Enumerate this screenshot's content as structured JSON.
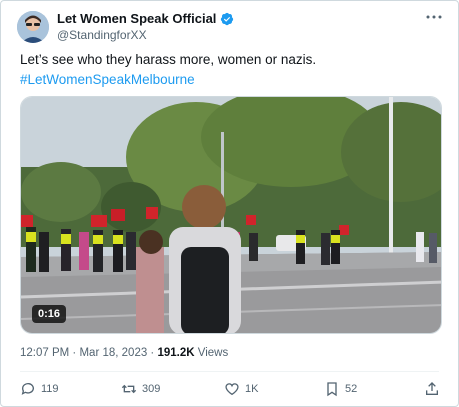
{
  "author": {
    "display_name": "Let Women Speak Official",
    "handle": "@StandingforXX",
    "verified": true
  },
  "tweet": {
    "text": "Let’s see who they harass more, women or nazis.",
    "hashtag": "#LetWomenSpeakMelbourne"
  },
  "media": {
    "type": "video",
    "duration": "0:16"
  },
  "meta": {
    "time": "12:07 PM",
    "separator": " · ",
    "date": "Mar 18, 2023",
    "views_count": "191.2K",
    "views_label": " Views"
  },
  "actions": {
    "replies": "119",
    "retweets": "309",
    "likes": "1K",
    "bookmarks": "52"
  },
  "colors": {
    "accent": "#1d9bf0",
    "text": "#0f1419",
    "secondary": "#536471"
  }
}
